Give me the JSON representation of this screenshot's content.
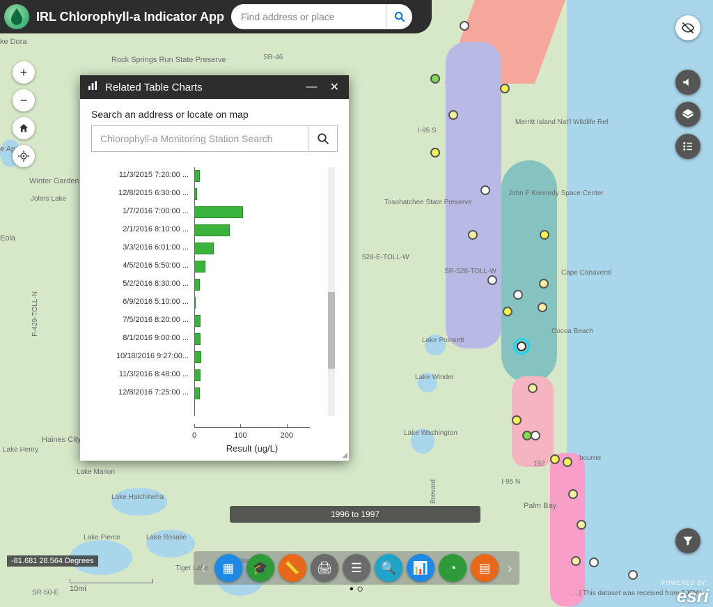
{
  "app": {
    "title": "IRL Chlorophyll-a Indicator App"
  },
  "header_search": {
    "placeholder": "Find address or place"
  },
  "panel": {
    "title": "Related Table Charts",
    "prompt": "Search an address or locate on map",
    "search_placeholder": "Chlorophyll-a Monitoring Station Search"
  },
  "chart_data": {
    "type": "bar",
    "orientation": "horizontal",
    "xlabel": "Result (ug/L)",
    "xlim": [
      0,
      250
    ],
    "xticks": [
      0,
      100,
      200
    ],
    "categories": [
      "11/3/2015 7:20:00 ...",
      "12/8/2015 6:30:00 ...",
      "1/7/2016 7:00:00 ...",
      "2/1/2016 8:10:00 ...",
      "3/3/2016 6:01:00 ...",
      "4/5/2016 5:50:00 ...",
      "5/2/2016 8:30:00 ...",
      "6/9/2016 5:10:00 ...",
      "7/5/2016 8:20:00 ...",
      "8/1/2016 9:00:00 ...",
      "10/18/2016 9:27:00...",
      "11/3/2016 8:48:00 ...",
      "12/8/2016 7:25:00 ..."
    ],
    "values": [
      12,
      6,
      105,
      77,
      42,
      24,
      12,
      3,
      14,
      13,
      15,
      13,
      12
    ],
    "bar_color": "#3bb23b"
  },
  "time_slider": {
    "label": "1996 to 1997"
  },
  "coords": {
    "text": "-81.681 28.564 Degrees"
  },
  "scale": {
    "label": "10mi"
  },
  "attribution": {
    "text": "... | This dataset was received from SJRW..."
  },
  "esri": {
    "powered": "POWERED BY",
    "logo": "esri"
  },
  "map_labels": {
    "rock_springs": "Rock Springs\nRun State\nPreserve",
    "apopka": "e Apopka",
    "winter_garden": "Winter Garden",
    "dora": "ke Dora",
    "johns_lake": "Johns\nLake",
    "eola": "Eola",
    "haines": "Haines City",
    "henry": "Lake\nHenry",
    "marion": "Lake\nMarion",
    "hatchineha": "Lake\nHatchineha",
    "pierce": "Lake\nPierce",
    "rosalie": "Lake\nRosalie",
    "tiger": "Tiger\nLake",
    "kissimmee": "Lake\nKissimmee",
    "sr46": "SR-46",
    "tosohatchee": "Tosohatchee\nState\nPreserve",
    "merritt": "Merritt\nIsland Nat'l\nWildlife Ref",
    "kennedy": "John F Kennedy\nSpace Center",
    "cape": "Cape\nCanaveral",
    "cocoa": "Cocoa Beach",
    "poinsett": "Lake\nPoinsett",
    "winder": "Lake\nWinder",
    "washington": "Lake\nWashington",
    "bourne": "bourne",
    "palmbay": "Palm Bay",
    "toll528a": "528-E-TOLL-W",
    "toll528b": "SR-528-TOLL-W",
    "i95a": "I-95 S",
    "i95b": "I-95 N",
    "sr50e": "SR-50-E",
    "f429": "F-429-TOLL-N",
    "brevard": "Brevard",
    "hwy192": "192"
  },
  "dock": {
    "btns": [
      {
        "name": "basemap-button",
        "color": "#1e88e5",
        "glyph": "▦"
      },
      {
        "name": "education-button",
        "color": "#2e9a3a",
        "glyph": "🎓"
      },
      {
        "name": "measure-button",
        "color": "#e8671b",
        "glyph": "📏"
      },
      {
        "name": "print-button",
        "color": "#6b6b6b",
        "glyph": "🖨"
      },
      {
        "name": "table-button",
        "color": "#6b6b6b",
        "glyph": "☰"
      },
      {
        "name": "query-button",
        "color": "#1fa3c7",
        "glyph": "🔍"
      },
      {
        "name": "charts-button",
        "color": "#1e88e5",
        "glyph": "📊"
      },
      {
        "name": "time-button",
        "color": "#2e9a3a",
        "glyph": "◔"
      },
      {
        "name": "grid-button",
        "color": "#e8671b",
        "glyph": "▤"
      }
    ]
  }
}
